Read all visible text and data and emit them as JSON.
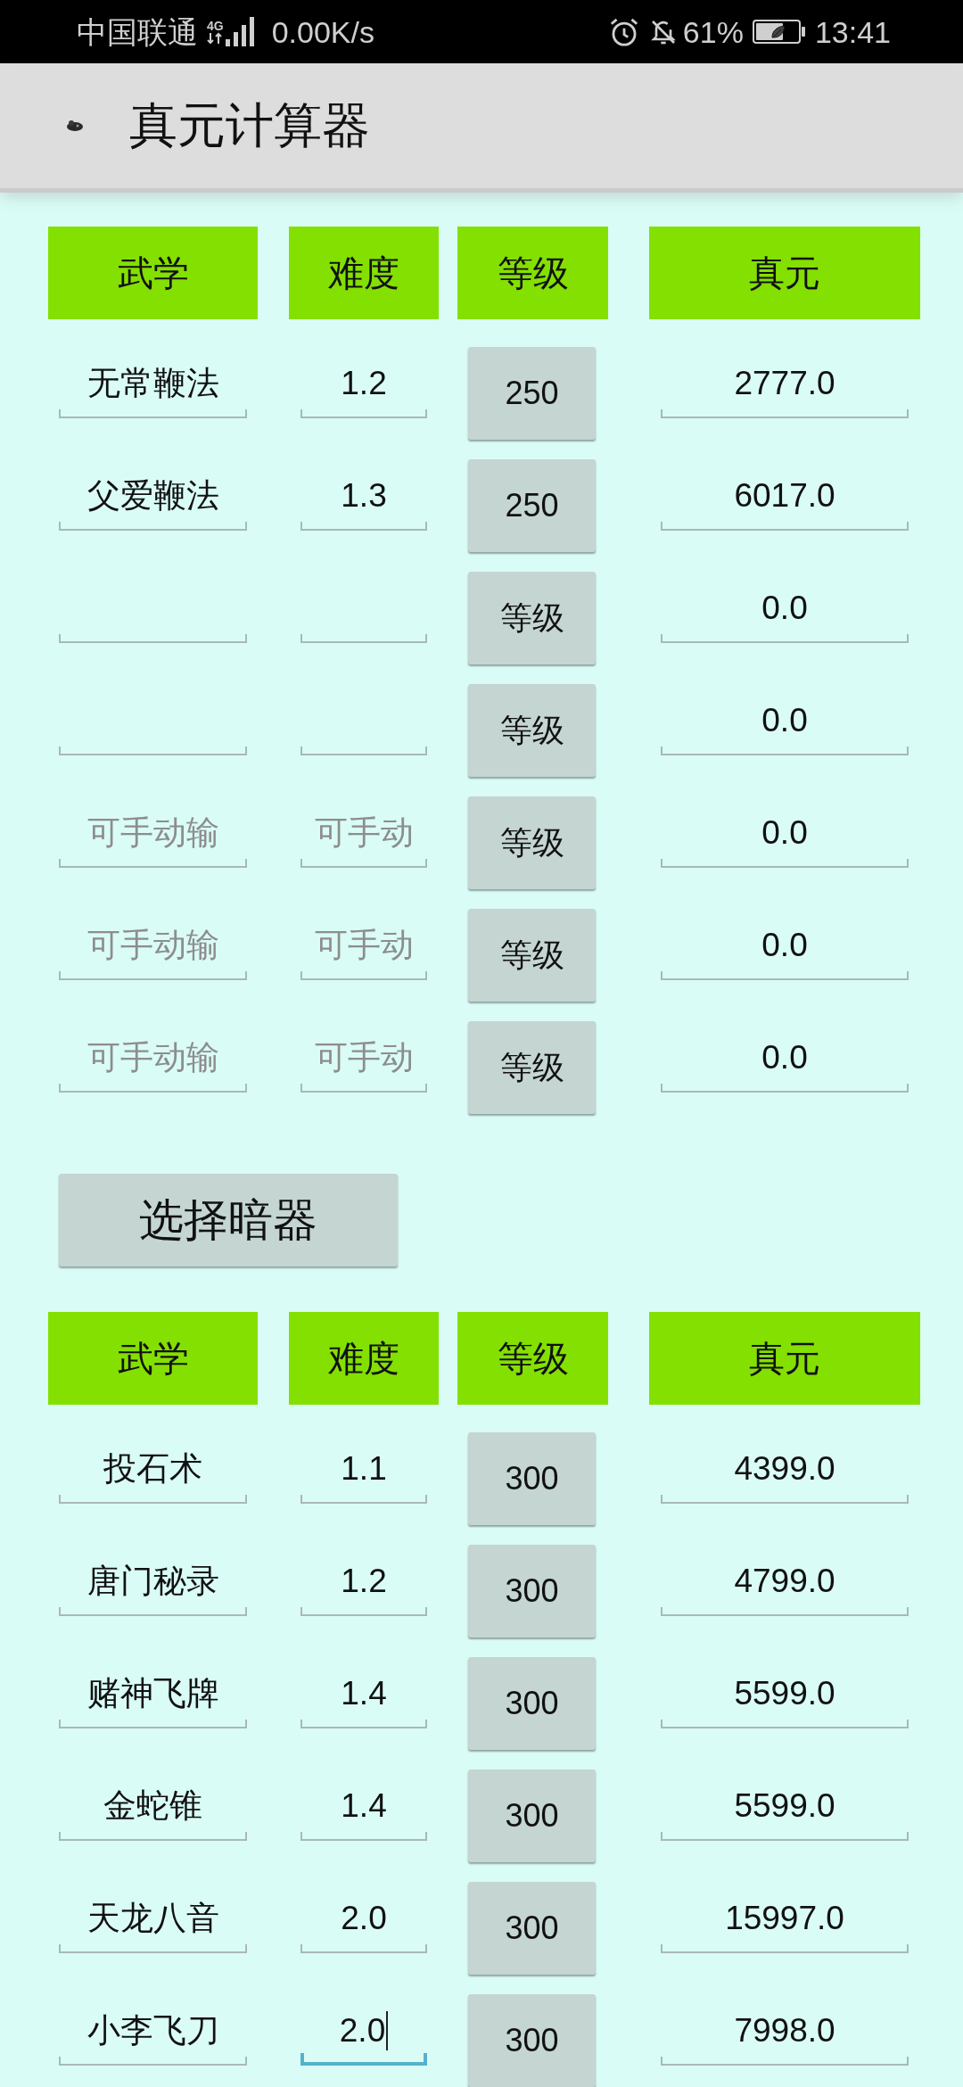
{
  "status_bar": {
    "carrier": "中国联通",
    "network_type": "4G",
    "speed": "0.00K/s",
    "battery": "61%",
    "time": "13:41"
  },
  "app_bar": {
    "title": "真元计算器"
  },
  "skills_table": {
    "columns": [
      "武学",
      "难度",
      "等级",
      "真元"
    ],
    "rows": [
      {
        "name": {
          "value": "无常鞭法"
        },
        "difficulty": {
          "value": "1.2",
          "focused": false
        },
        "level": "250",
        "result": "2777.0"
      },
      {
        "name": {
          "value": "父爱鞭法"
        },
        "difficulty": {
          "value": "1.3",
          "focused": false
        },
        "level": "250",
        "result": "6017.0"
      },
      {
        "difficulty": {
          "focused": false
        },
        "level": "等级",
        "result": "0.0"
      },
      {
        "difficulty": {
          "focused": false
        },
        "level": "等级",
        "result": "0.0"
      },
      {
        "name": {
          "placeholder": "可手动输"
        },
        "difficulty": {
          "placeholder": "可手动",
          "focused": false
        },
        "level": "等级",
        "result": "0.0"
      },
      {
        "name": {
          "placeholder": "可手动输"
        },
        "difficulty": {
          "placeholder": "可手动",
          "focused": false
        },
        "level": "等级",
        "result": "0.0"
      },
      {
        "name": {
          "placeholder": "可手动输"
        },
        "difficulty": {
          "placeholder": "可手动",
          "focused": false
        },
        "level": "等级",
        "result": "0.0"
      }
    ]
  },
  "weapon_button": "选择暗器",
  "weapons_table": {
    "columns": [
      "武学",
      "难度",
      "等级",
      "真元"
    ],
    "rows": [
      {
        "name": {
          "value": "投石术"
        },
        "difficulty": {
          "value": "1.1",
          "focused": false
        },
        "level": "300",
        "result": "4399.0"
      },
      {
        "name": {
          "value": "唐门秘录"
        },
        "difficulty": {
          "value": "1.2",
          "focused": false
        },
        "level": "300",
        "result": "4799.0"
      },
      {
        "name": {
          "value": "赌神飞牌"
        },
        "difficulty": {
          "value": "1.4",
          "focused": false
        },
        "level": "300",
        "result": "5599.0"
      },
      {
        "name": {
          "value": "金蛇锥"
        },
        "difficulty": {
          "value": "1.4",
          "focused": false
        },
        "level": "300",
        "result": "5599.0"
      },
      {
        "name": {
          "value": "天龙八音"
        },
        "difficulty": {
          "value": "2.0",
          "focused": false
        },
        "level": "300",
        "result": "15997.0"
      },
      {
        "name": {
          "value": "小李飞刀"
        },
        "difficulty": {
          "value": "2.0",
          "focused": true
        },
        "level": "300",
        "result": "7998.0"
      }
    ]
  }
}
